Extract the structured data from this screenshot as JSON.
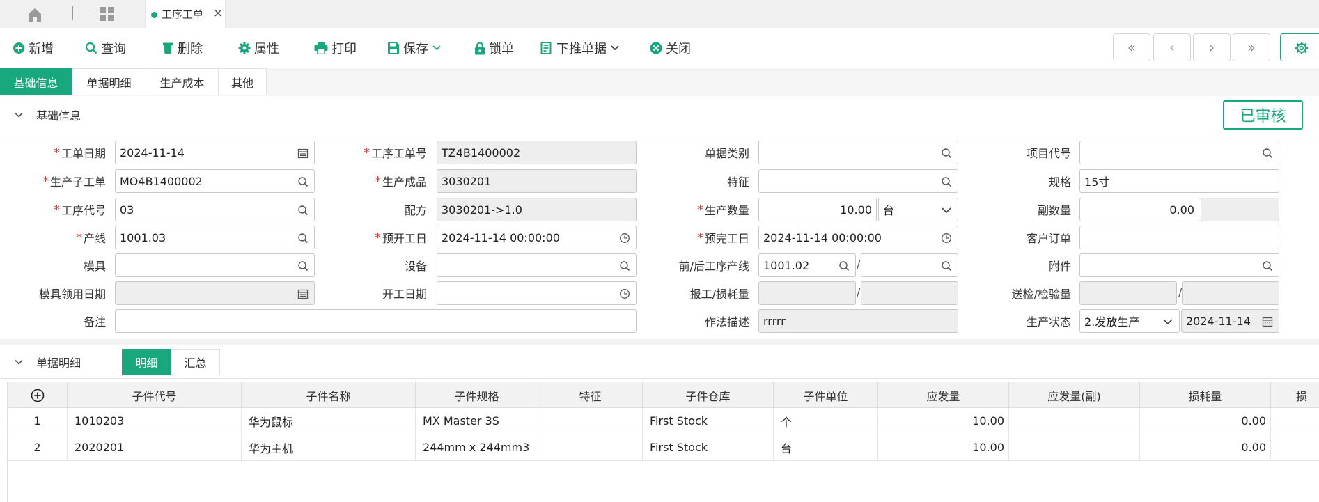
{
  "tab": {
    "doc_title": "工序工单",
    "close": "×"
  },
  "toolbar": {
    "new": "新增",
    "query": "查询",
    "delete": "删除",
    "props": "属性",
    "print": "打印",
    "save": "保存",
    "lock": "锁单",
    "push": "下推单据",
    "close": "关闭"
  },
  "nav": {
    "first": "«",
    "prev": "‹",
    "next": "›",
    "last": "»"
  },
  "sections": {
    "tabs": [
      "基础信息",
      "单据明细",
      "生产成本",
      "其他"
    ],
    "basic_title": "基础信息",
    "detail_title": "单据明细"
  },
  "status_stamp": "已审核",
  "form": {
    "work_date": {
      "label": "工单日期",
      "value": "2024-11-14"
    },
    "wo_no": {
      "label": "工序工单号",
      "value": "TZ4B1400002"
    },
    "doc_type": {
      "label": "单据类别",
      "value": ""
    },
    "project_code": {
      "label": "项目代号",
      "value": ""
    },
    "sub_wo": {
      "label": "生产子工单",
      "value": "MO4B1400002"
    },
    "product": {
      "label": "生产成品",
      "value": "3030201"
    },
    "feature": {
      "label": "特征",
      "value": ""
    },
    "spec": {
      "label": "规格",
      "value": "15寸"
    },
    "process_code": {
      "label": "工序代号",
      "value": "03"
    },
    "recipe": {
      "label": "配方",
      "value": "3030201->1.0"
    },
    "qty": {
      "label": "生产数量",
      "value": "10.00",
      "unit": "台"
    },
    "sub_qty": {
      "label": "副数量",
      "value": "0.00"
    },
    "line": {
      "label": "产线",
      "value": "1001.03"
    },
    "plan_start": {
      "label": "预开工日",
      "value": "2024-11-14 00:00:00"
    },
    "plan_end": {
      "label": "预完工日",
      "value": "2024-11-14 00:00:00"
    },
    "customer_order": {
      "label": "客户订单",
      "value": ""
    },
    "mold": {
      "label": "模具",
      "value": ""
    },
    "equipment": {
      "label": "设备",
      "value": ""
    },
    "prev_next_line": {
      "label": "前/后工序产线",
      "value": "1001.02",
      "value2": ""
    },
    "attachment": {
      "label": "附件",
      "value": ""
    },
    "mold_date": {
      "label": "模具领用日期",
      "value": ""
    },
    "start_date": {
      "label": "开工日期",
      "value": ""
    },
    "report_loss": {
      "label": "报工/损耗量",
      "value": "",
      "value2": ""
    },
    "inspect_qty": {
      "label": "送检/检验量",
      "value": "",
      "value2": ""
    },
    "remark": {
      "label": "备注",
      "value": ""
    },
    "method": {
      "label": "作法描述",
      "value": "rrrrr"
    },
    "prod_status": {
      "label": "生产状态",
      "value": "2.发放生产",
      "date": "2024-11-14"
    },
    "slash": "/"
  },
  "detail": {
    "subtabs": [
      "明细",
      "汇总"
    ],
    "columns": [
      "子件代号",
      "子件名称",
      "子件规格",
      "特征",
      "子件仓库",
      "子件单位",
      "应发量",
      "应发量(副)",
      "损耗量",
      "损"
    ],
    "rows": [
      {
        "no": "1",
        "code": "1010203",
        "name": "华为鼠标",
        "spec": "MX Master 3S",
        "feature": "",
        "warehouse": "First Stock",
        "unit": "个",
        "qty": "10.00",
        "qty2": "",
        "loss": "0.00"
      },
      {
        "no": "2",
        "code": "2020201",
        "name": "华为主机",
        "spec": "244mm x 244mm3",
        "feature": "",
        "warehouse": "First Stock",
        "unit": "台",
        "qty": "10.00",
        "qty2": "",
        "loss": "0.00"
      }
    ]
  },
  "colors": {
    "accent": "#19a87d",
    "required": "#e63a3a"
  }
}
